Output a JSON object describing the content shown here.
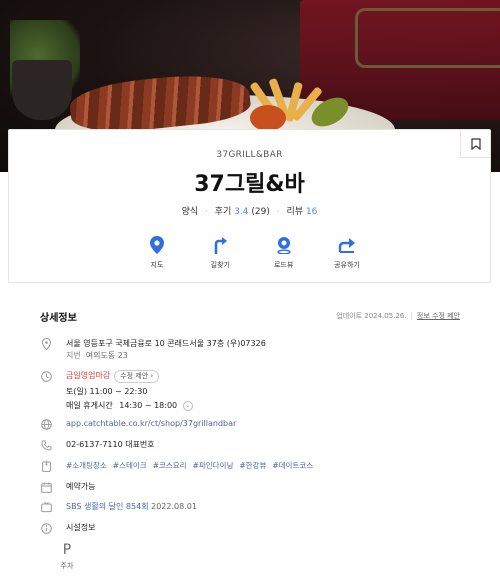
{
  "hero": {
    "alt_icon": "restaurant-photo"
  },
  "card": {
    "english_name": "37GRILL&BAR",
    "name": "37그릴&바",
    "category": "양식",
    "reviews_label": "후기",
    "rating": "3.4",
    "review_count": "(29)",
    "blog_reviews_label": "리뷰",
    "blog_review_count": "16",
    "actions": [
      {
        "label": "지도",
        "icon": "map-pin-icon"
      },
      {
        "label": "길찾기",
        "icon": "directions-icon"
      },
      {
        "label": "로드뷰",
        "icon": "roadview-icon"
      },
      {
        "label": "공유하기",
        "icon": "share-icon"
      }
    ]
  },
  "details": {
    "title": "상세정보",
    "updated": "업데이트 2024.05.26.",
    "suggest_link": "정보 수정 제안",
    "address": "서울 영등포구 국제금융로 10 콘래드서울 37층 (우)07326",
    "jibun_label": "지번",
    "jibun": "여의도동 23",
    "hours_status": "금일영업마감",
    "hours_suggest": "수정 제안",
    "hours_line1": "토(일) 11:00 ~ 22:30",
    "hours_line2_label": "매일 휴게시간",
    "hours_line2": "14:30 ~ 18:00",
    "website": "app.catchtable.co.kr/ct/shop/37grillandbar",
    "phone": "02-6137-7110 대표번호",
    "tags": [
      "#소개팅장소",
      "#스테이크",
      "#코스요리",
      "#파인다이닝",
      "#한강뷰",
      "#데이트코스"
    ],
    "reservation": "예약가능",
    "tv_show": "SBS 생활의 달인 854회",
    "tv_date": "2022.08.01",
    "facilities_title": "시설정보",
    "facility_parking_glyph": "P",
    "facility_parking_label": "주차"
  },
  "colors": {
    "accent_blue": "#4b89dc",
    "closed_red": "#e0463b"
  }
}
